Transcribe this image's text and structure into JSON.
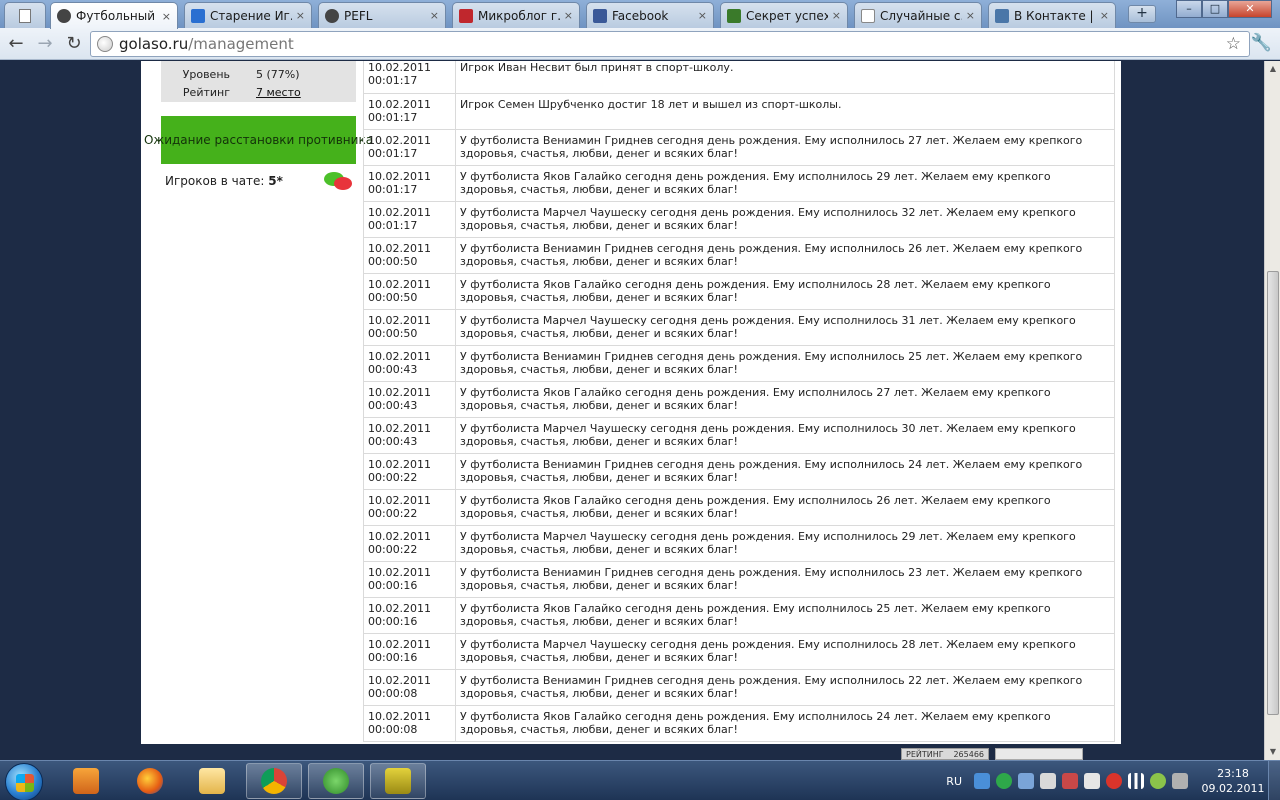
{
  "browser": {
    "tabs": [
      {
        "label": "Футбольный ...",
        "icon": "soccer-ball-icon",
        "active": true
      },
      {
        "label": "Старение Иг...",
        "icon": "blue-v-icon",
        "active": false
      },
      {
        "label": "PEFL",
        "icon": "soccer-ball-icon",
        "active": false
      },
      {
        "label": "Микроблог г...",
        "icon": "red-shield-icon",
        "active": false
      },
      {
        "label": "Facebook",
        "icon": "facebook-icon",
        "active": false
      },
      {
        "label": "Секрет успех...",
        "icon": "green-image-icon",
        "active": false
      },
      {
        "label": "Случайные с...",
        "icon": "page-icon",
        "active": false
      },
      {
        "label": "В Контакте | ...",
        "icon": "vk-icon",
        "active": false
      }
    ],
    "url_host": "golaso.ru",
    "url_path": "/management"
  },
  "sidebar": {
    "level_label": "Уровень",
    "level_value": "5 (77%)",
    "rating_label": "Рейтинг",
    "rating_value": "7 место",
    "waiting_text": "Ожидание расстановки противника",
    "chat_label": "Игроков в чате:",
    "chat_count": "5*"
  },
  "log": [
    {
      "date": "10.02.2011",
      "time": "00:01:17",
      "msg": "Игрок Иван Несвит был принят в спорт-школу."
    },
    {
      "date": "10.02.2011",
      "time": "00:01:17",
      "msg": "Игрок Семен Шрубченко достиг 18 лет и вышел из спорт-школы."
    },
    {
      "date": "10.02.2011",
      "time": "00:01:17",
      "msg": "У футболиста Вениамин Гриднев сегодня день рождения. Ему исполнилось 27 лет. Желаем ему крепкого здоровья, счастья, любви, денег и всяких благ!"
    },
    {
      "date": "10.02.2011",
      "time": "00:01:17",
      "msg": "У футболиста Яков Галайко сегодня день рождения. Ему исполнилось 29 лет. Желаем ему крепкого здоровья, счастья, любви, денег и всяких благ!"
    },
    {
      "date": "10.02.2011",
      "time": "00:01:17",
      "msg": "У футболиста Марчел Чаушеску сегодня день рождения. Ему исполнилось 32 лет. Желаем ему крепкого здоровья, счастья, любви, денег и всяких благ!"
    },
    {
      "date": "10.02.2011",
      "time": "00:00:50",
      "msg": "У футболиста Вениамин Гриднев сегодня день рождения. Ему исполнилось 26 лет. Желаем ему крепкого здоровья, счастья, любви, денег и всяких благ!"
    },
    {
      "date": "10.02.2011",
      "time": "00:00:50",
      "msg": "У футболиста Яков Галайко сегодня день рождения. Ему исполнилось 28 лет. Желаем ему крепкого здоровья, счастья, любви, денег и всяких благ!"
    },
    {
      "date": "10.02.2011",
      "time": "00:00:50",
      "msg": "У футболиста Марчел Чаушеску сегодня день рождения. Ему исполнилось 31 лет. Желаем ему крепкого здоровья, счастья, любви, денег и всяких благ!"
    },
    {
      "date": "10.02.2011",
      "time": "00:00:43",
      "msg": "У футболиста Вениамин Гриднев сегодня день рождения. Ему исполнилось 25 лет. Желаем ему крепкого здоровья, счастья, любви, денег и всяких благ!"
    },
    {
      "date": "10.02.2011",
      "time": "00:00:43",
      "msg": "У футболиста Яков Галайко сегодня день рождения. Ему исполнилось 27 лет. Желаем ему крепкого здоровья, счастья, любви, денег и всяких благ!"
    },
    {
      "date": "10.02.2011",
      "time": "00:00:43",
      "msg": "У футболиста Марчел Чаушеску сегодня день рождения. Ему исполнилось 30 лет. Желаем ему крепкого здоровья, счастья, любви, денег и всяких благ!"
    },
    {
      "date": "10.02.2011",
      "time": "00:00:22",
      "msg": "У футболиста Вениамин Гриднев сегодня день рождения. Ему исполнилось 24 лет. Желаем ему крепкого здоровья, счастья, любви, денег и всяких благ!"
    },
    {
      "date": "10.02.2011",
      "time": "00:00:22",
      "msg": "У футболиста Яков Галайко сегодня день рождения. Ему исполнилось 26 лет. Желаем ему крепкого здоровья, счастья, любви, денег и всяких благ!"
    },
    {
      "date": "10.02.2011",
      "time": "00:00:22",
      "msg": "У футболиста Марчел Чаушеску сегодня день рождения. Ему исполнилось 29 лет. Желаем ему крепкого здоровья, счастья, любви, денег и всяких благ!"
    },
    {
      "date": "10.02.2011",
      "time": "00:00:16",
      "msg": "У футболиста Вениамин Гриднев сегодня день рождения. Ему исполнилось 23 лет. Желаем ему крепкого здоровья, счастья, любви, денег и всяких благ!"
    },
    {
      "date": "10.02.2011",
      "time": "00:00:16",
      "msg": "У футболиста Яков Галайко сегодня день рождения. Ему исполнилось 25 лет. Желаем ему крепкого здоровья, счастья, любви, денег и всяких благ!"
    },
    {
      "date": "10.02.2011",
      "time": "00:00:16",
      "msg": "У футболиста Марчел Чаушеску сегодня день рождения. Ему исполнилось 28 лет. Желаем ему крепкого здоровья, счастья, любви, денег и всяких благ!"
    },
    {
      "date": "10.02.2011",
      "time": "00:00:08",
      "msg": "У футболиста Вениамин Гриднев сегодня день рождения. Ему исполнилось 22 лет. Желаем ему крепкого здоровья, счастья, любви, денег и всяких благ!"
    },
    {
      "date": "10.02.2011",
      "time": "00:00:08",
      "msg": "У футболиста Яков Галайко сегодня день рождения. Ему исполнилось 24 лет. Желаем ему крепкого здоровья, счастья, любви, денег и всяких благ!"
    }
  ],
  "counter": {
    "label": "РЕЙТИНГ",
    "value": "265466"
  },
  "taskbar": {
    "lang": "RU",
    "time": "23:18",
    "date": "09.02.2011",
    "apps": [
      "media-player-icon",
      "firefox-icon",
      "explorer-folder-icon",
      "chrome-icon",
      "utorrent-icon",
      "game-app-icon"
    ]
  },
  "colors": {
    "accent_green": "#45b11b",
    "page_bg": "#1d2b45"
  }
}
